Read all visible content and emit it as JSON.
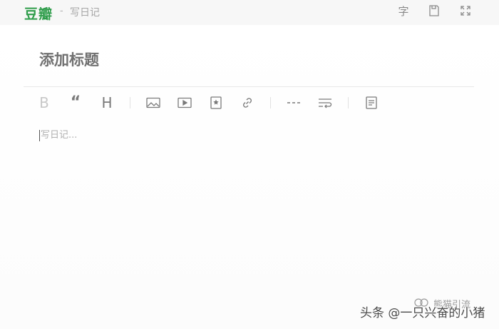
{
  "header": {
    "logo": "豆瓣",
    "separator": "-",
    "breadcrumb": "写日记",
    "word_count_label": "字",
    "icons": [
      "word-count-icon",
      "save-draft-icon",
      "fullscreen-icon"
    ]
  },
  "editor": {
    "title_placeholder": "添加标题",
    "body_placeholder": "写日记..."
  },
  "toolbar": {
    "bold_label": "B",
    "quote_label": "“",
    "heading_label": "H",
    "tools": [
      "bold",
      "quote",
      "heading",
      "image",
      "video",
      "product",
      "link",
      "divider",
      "line-break",
      "summary"
    ]
  },
  "watermark": {
    "text": "头条 @一只兴奋的小猪",
    "small_text": "熊猫引流"
  },
  "colors": {
    "brand": "#2f9d4b",
    "topbar": "#f7f7f7",
    "icon": "#7a7a7a"
  }
}
